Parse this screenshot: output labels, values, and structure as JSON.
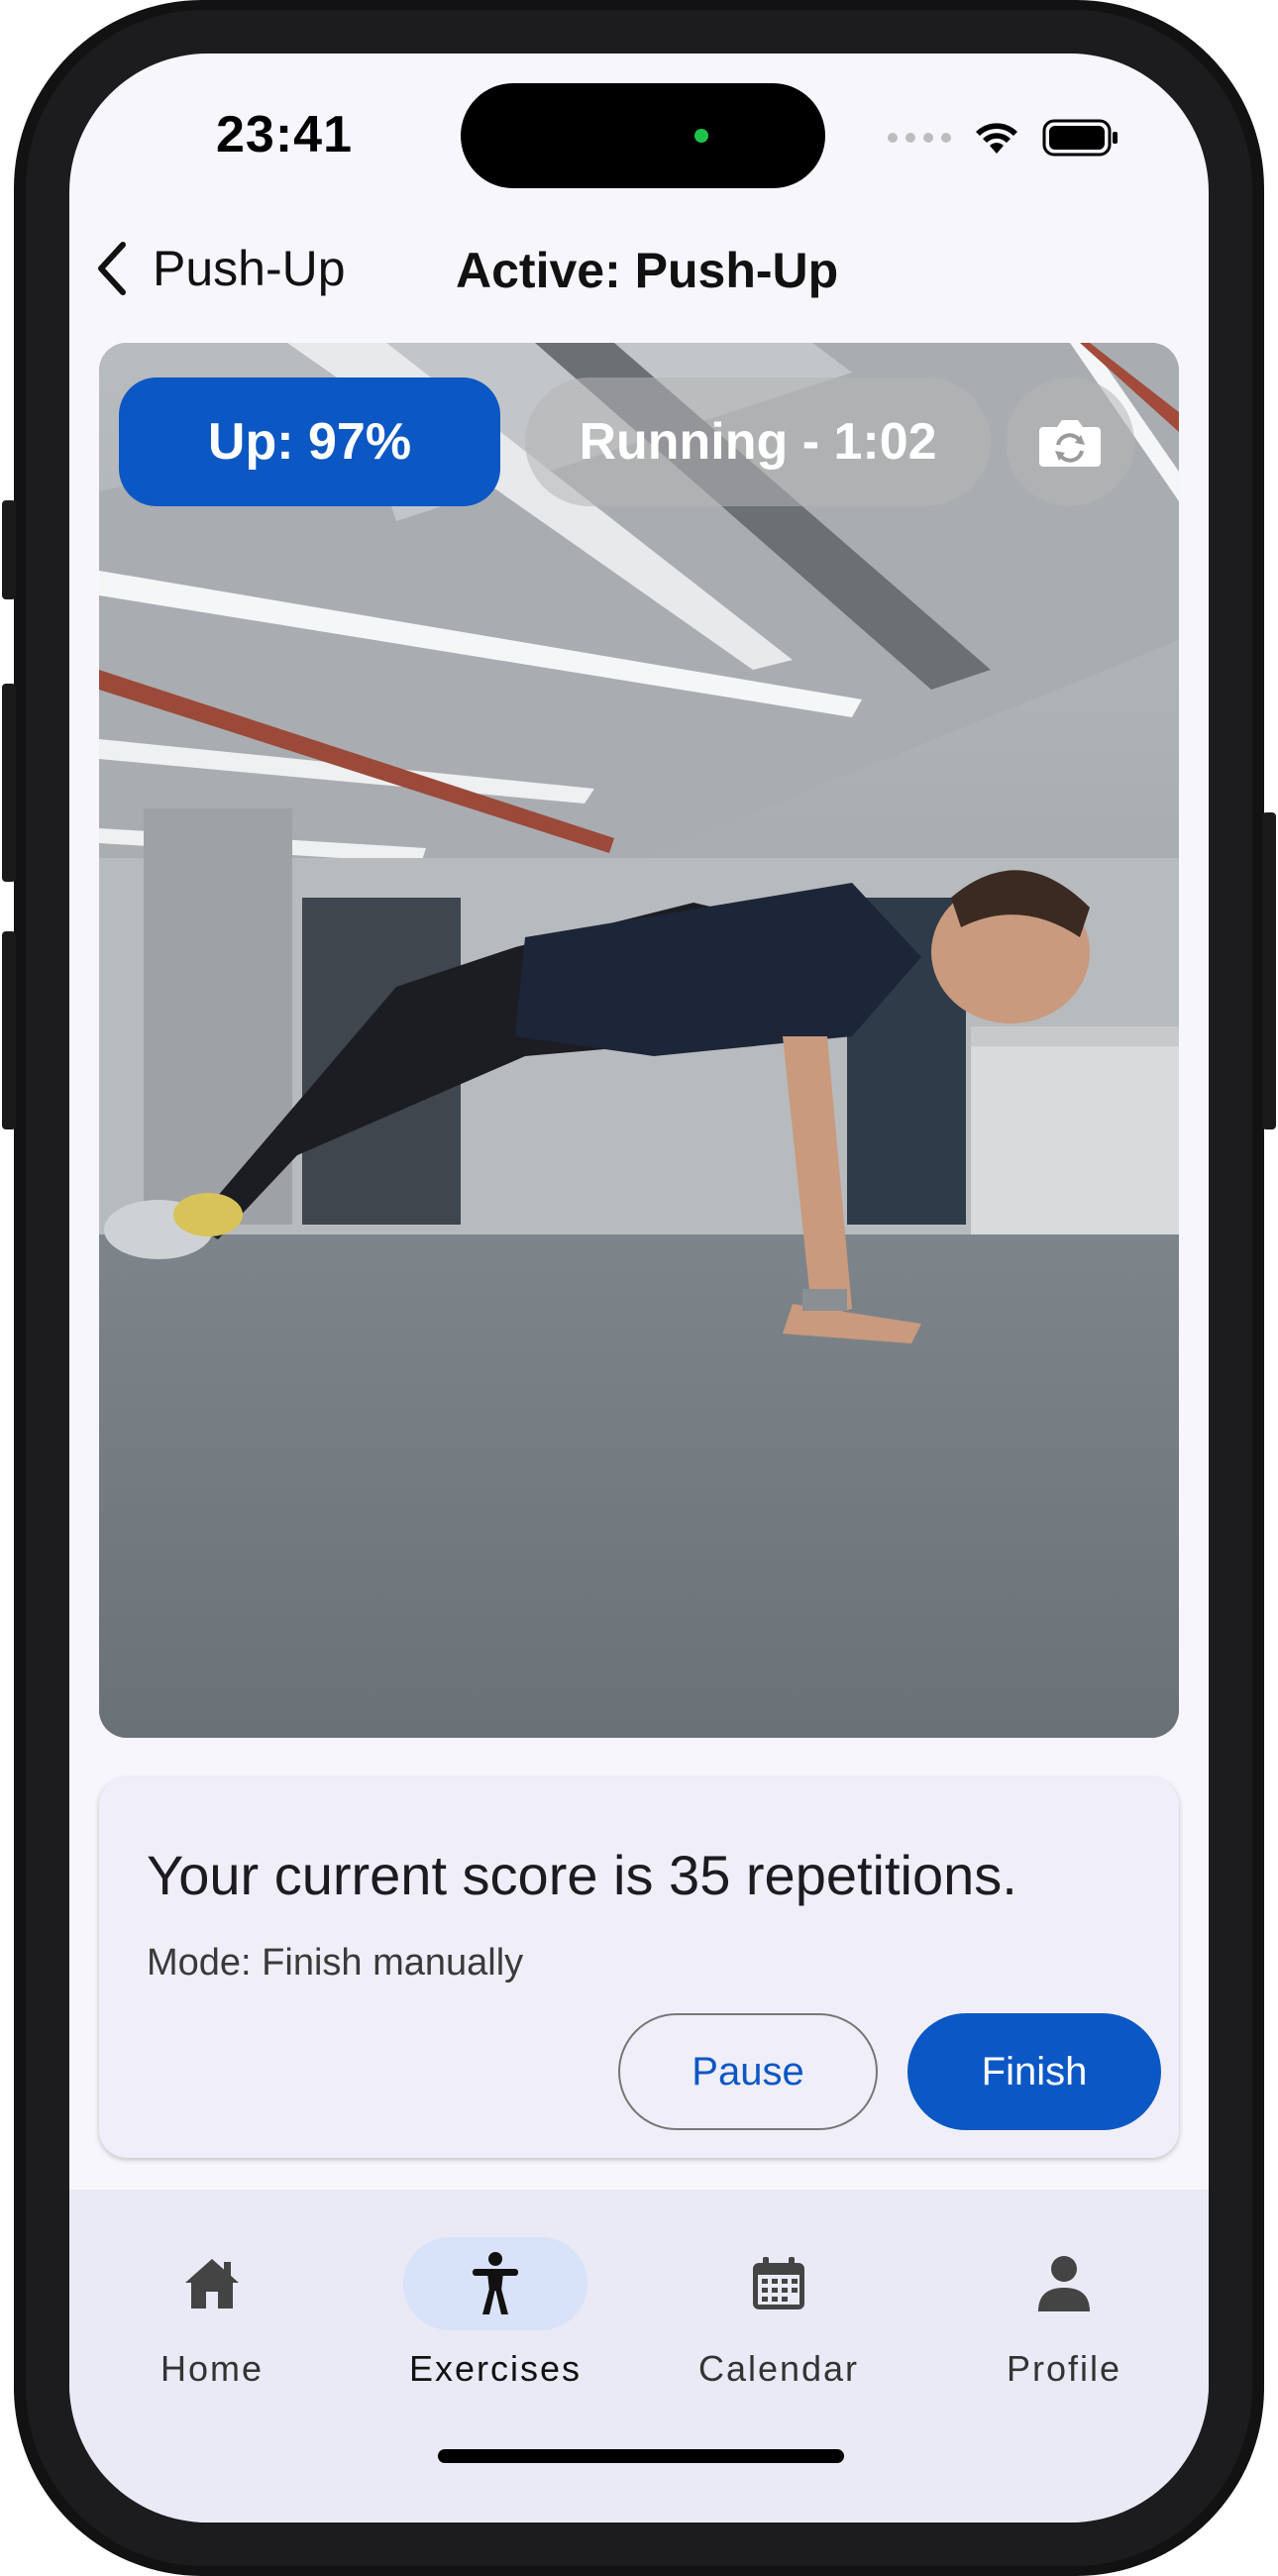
{
  "status_bar": {
    "time": "23:41"
  },
  "nav": {
    "back_label": "Push-Up",
    "title": "Active: Push-Up"
  },
  "camera": {
    "phase_badge": "Up: 97%",
    "timer_badge": "Running - 1:02",
    "flip_icon": "camera-flip-icon"
  },
  "score_card": {
    "score_text": "Your current score is 35 repetitions.",
    "mode_text": "Mode: Finish manually",
    "pause_label": "Pause",
    "finish_label": "Finish"
  },
  "tabs": [
    {
      "label": "Home",
      "icon": "home-icon",
      "active": false
    },
    {
      "label": "Exercises",
      "icon": "person-icon",
      "active": true
    },
    {
      "label": "Calendar",
      "icon": "calendar-icon",
      "active": false
    },
    {
      "label": "Profile",
      "icon": "profile-icon",
      "active": false
    }
  ],
  "colors": {
    "accent": "#0b57c4",
    "tab_active_bg": "#d8e2f8",
    "background": "#f8f6fd"
  }
}
